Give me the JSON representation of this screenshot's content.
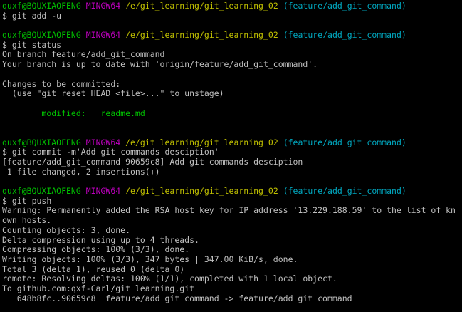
{
  "prompt": {
    "user_host": "quxf@BQUXIAOFENG",
    "system": "MINGW64",
    "path": "/e/git_learning/git_learning_02",
    "branch": "(feature/add_git_command)",
    "symbol": "$"
  },
  "blocks": [
    {
      "command": "git add -u",
      "output": []
    },
    {
      "command": "git status",
      "output": [
        {
          "text": "On branch feature/add_git_command",
          "color": "white"
        },
        {
          "text": "Your branch is up to date with 'origin/feature/add_git_command'.",
          "color": "white"
        },
        {
          "text": "",
          "color": "white"
        },
        {
          "text": "Changes to be committed:",
          "color": "white"
        },
        {
          "text": "  (use \"git reset HEAD <file>...\" to unstage)",
          "color": "white"
        },
        {
          "text": "",
          "color": "white"
        },
        {
          "text": "        modified:   readme.md",
          "color": "green"
        },
        {
          "text": "",
          "color": "white"
        },
        {
          "text": "",
          "color": "white"
        }
      ]
    },
    {
      "command": "git commit -m'Add git commands desciption'",
      "output": [
        {
          "text": "[feature/add_git_command 90659c8] Add git commands desciption",
          "color": "white"
        },
        {
          "text": " 1 file changed, 2 insertions(+)",
          "color": "white"
        },
        {
          "text": "",
          "color": "white"
        }
      ]
    },
    {
      "command": "git push",
      "output": [
        {
          "text": "Warning: Permanently added the RSA host key for IP address '13.229.188.59' to the list of kn",
          "color": "white"
        },
        {
          "text": "own hosts.",
          "color": "white"
        },
        {
          "text": "Counting objects: 3, done.",
          "color": "white"
        },
        {
          "text": "Delta compression using up to 4 threads.",
          "color": "white"
        },
        {
          "text": "Compressing objects: 100% (3/3), done.",
          "color": "white"
        },
        {
          "text": "Writing objects: 100% (3/3), 347 bytes | 347.00 KiB/s, done.",
          "color": "white"
        },
        {
          "text": "Total 3 (delta 1), reused 0 (delta 0)",
          "color": "white"
        },
        {
          "text": "remote: Resolving deltas: 100% (1/1), completed with 1 local object.",
          "color": "white"
        },
        {
          "text": "To github.com:qxf-Carl/git_learning.git",
          "color": "white"
        },
        {
          "text": "   648b8fc..90659c8  feature/add_git_command -> feature/add_git_command",
          "color": "white"
        }
      ]
    }
  ],
  "colors": {
    "background": "#000000",
    "text": "#c0c0c0",
    "user_host": "#00c000",
    "system": "#c000c0",
    "path": "#c0c000",
    "branch": "#00a8c0"
  }
}
